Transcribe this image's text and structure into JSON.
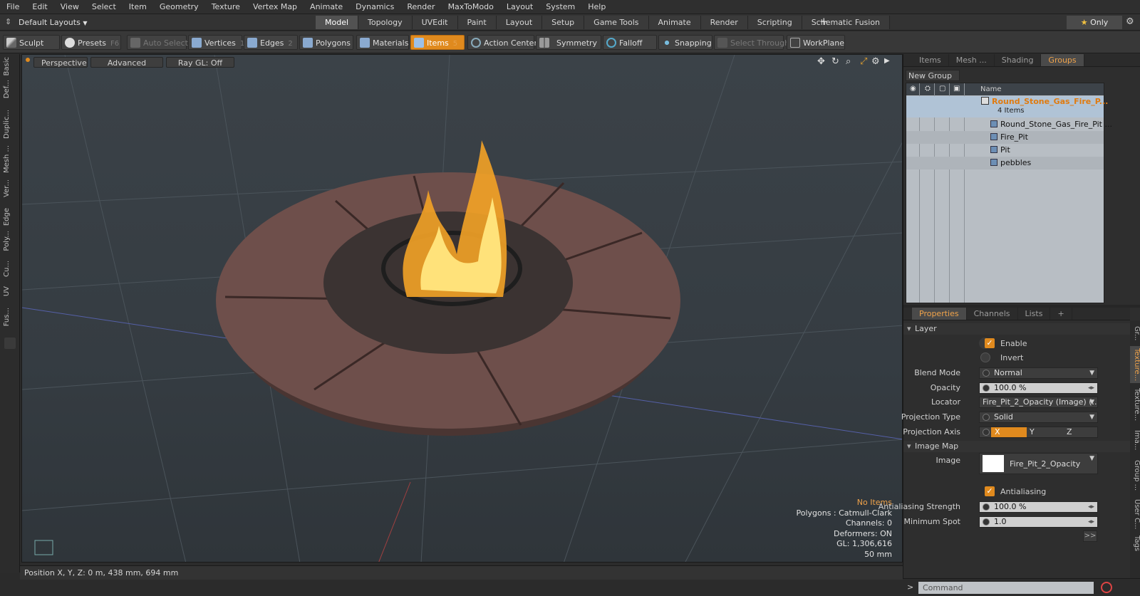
{
  "menu": [
    "File",
    "Edit",
    "View",
    "Select",
    "Item",
    "Geometry",
    "Texture",
    "Vertex Map",
    "Animate",
    "Dynamics",
    "Render",
    "MaxToModo",
    "Layout",
    "System",
    "Help"
  ],
  "layout_select": "Default Layouts",
  "layout_tabs": [
    {
      "label": "Model",
      "active": true
    },
    {
      "label": "Topology"
    },
    {
      "label": "UVEdit"
    },
    {
      "label": "Paint"
    },
    {
      "label": "Layout"
    },
    {
      "label": "Setup"
    },
    {
      "label": "Game Tools"
    },
    {
      "label": "Animate"
    },
    {
      "label": "Render"
    },
    {
      "label": "Scripting"
    },
    {
      "label": "Schematic Fusion"
    }
  ],
  "add_tab": "+",
  "only_label": "Only",
  "toolbar": {
    "sculpt": "Sculpt",
    "presets": "Presets",
    "presets_key": "F6",
    "auto_select": "Auto Select",
    "vertices": "Vertices",
    "vertices_key": "1",
    "edges": "Edges",
    "edges_key": "2",
    "polygons": "Polygons",
    "materials": "Materials",
    "items": "Items",
    "items_key": "5",
    "action_center": "Action Center",
    "symmetry": "Symmetry",
    "falloff": "Falloff",
    "snapping": "Snapping",
    "select_through": "Select Through",
    "workplane": "WorkPlane"
  },
  "left_tabs": [
    "Basic",
    "Def...",
    "Duplic...",
    "Mesh ...",
    "Ver...",
    "Edge",
    "Poly...",
    "Cu...",
    "UV",
    "Fus..."
  ],
  "viewport": {
    "perspective": "Perspective",
    "advanced": "Advanced",
    "raygl": "Ray GL: Off",
    "info": [
      "No Items",
      "Polygons : Catmull-Clark",
      "Channels: 0",
      "Deformers: ON",
      "GL: 1,306,616",
      "50 mm"
    ]
  },
  "status": "Position X, Y, Z:   0 m, 438 mm, 694 mm",
  "panel_tabs": [
    {
      "label": "Items"
    },
    {
      "label": "Mesh ..."
    },
    {
      "label": "Shading"
    },
    {
      "label": "Groups",
      "active": true
    }
  ],
  "new_group": "New Group",
  "grid": {
    "name_header": "Name",
    "group_name": "Round_Stone_Gas_Fire_P...",
    "group_count": "4 Items",
    "rows": [
      "Round_Stone_Gas_Fire_Pit ...",
      "Fire_Pit",
      "Pit",
      "pebbles"
    ]
  },
  "prop_tabs": [
    {
      "label": "Properties",
      "active": true
    },
    {
      "label": "Channels"
    },
    {
      "label": "Lists"
    }
  ],
  "props": {
    "layer": "Layer",
    "enable": "Enable",
    "invert": "Invert",
    "blend_mode_label": "Blend Mode",
    "blend_mode": "Normal",
    "opacity_label": "Opacity",
    "opacity": "100.0 %",
    "locator_label": "Locator",
    "locator": "Fire_Pit_2_Opacity (Image) (...",
    "proj_type_label": "Projection Type",
    "proj_type": "Solid",
    "proj_axis_label": "Projection Axis",
    "axis_x": "X",
    "axis_y": "Y",
    "axis_z": "Z",
    "image_map": "Image Map",
    "image_label": "Image",
    "image": "Fire_Pit_2_Opacity",
    "antialiasing": "Antialiasing",
    "aa_strength_label": "Antialiasing Strength",
    "aa_strength": "100.0 %",
    "min_spot_label": "Minimum Spot",
    "min_spot": "1.0",
    "more": ">>"
  },
  "right_vtabs": [
    "Gr...",
    "Texture...",
    "Texture...",
    "Ima...",
    "Group ...",
    "User C...",
    "Tags"
  ],
  "command_placeholder": "Command",
  "colors": {
    "accent": "#e08a1e",
    "tab_active_text": "#f0a34a",
    "viewport_bg": "#3a4147"
  }
}
